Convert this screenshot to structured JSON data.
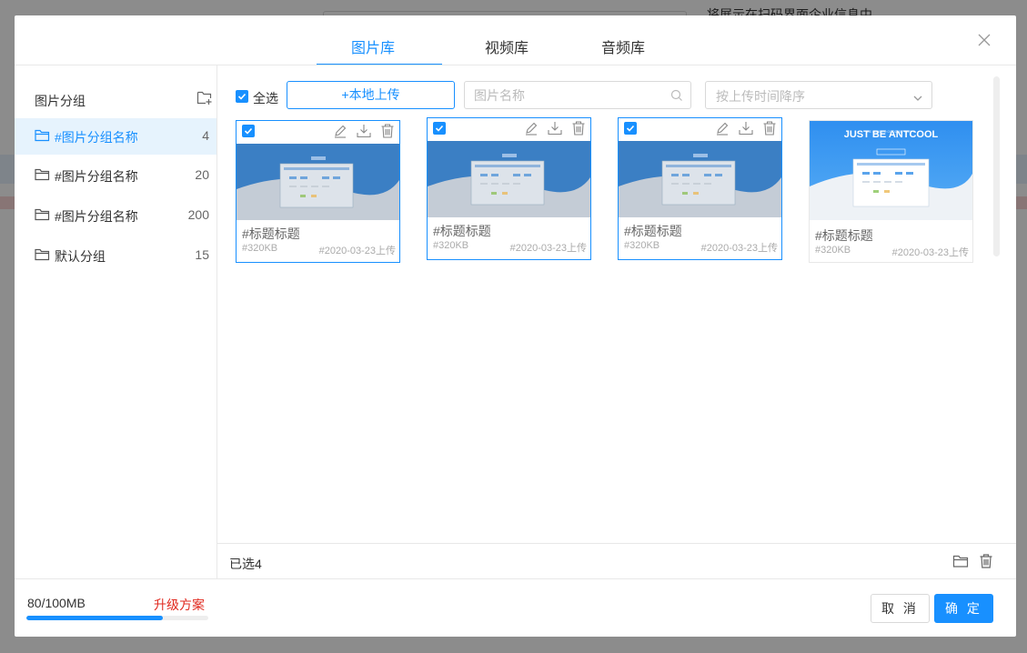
{
  "background": {
    "hint_text": "将展示在扫码界面企业信息中"
  },
  "tabs": [
    {
      "label": "图片库",
      "active": true
    },
    {
      "label": "视频库",
      "active": false
    },
    {
      "label": "音频库",
      "active": false
    }
  ],
  "sidebar": {
    "title": "图片分组",
    "groups": [
      {
        "name": "#图片分组名称",
        "count": "4",
        "active": true
      },
      {
        "name": "#图片分组名称",
        "count": "20",
        "active": false
      },
      {
        "name": "#图片分组名称",
        "count": "200",
        "active": false
      },
      {
        "name": "默认分组",
        "count": "15",
        "active": false
      }
    ]
  },
  "toolbar": {
    "select_all_label": "全选",
    "upload_label": "+本地上传",
    "search_placeholder": "图片名称",
    "sort_value": "按上传时间降序"
  },
  "thumbnail_heading": "JUST BE ANTCOOL",
  "cards": [
    {
      "title": "#标题标题",
      "size": "#320KB",
      "date": "#2020-03-23上传",
      "selected": true
    },
    {
      "title": "#标题标题",
      "size": "#320KB",
      "date": "#2020-03-23上传",
      "selected": true
    },
    {
      "title": "#标题标题",
      "size": "#320KB",
      "date": "#2020-03-23上传",
      "selected": true
    },
    {
      "title": "#标题标题",
      "size": "#320KB",
      "date": "#2020-03-23上传",
      "selected": false
    }
  ],
  "footer": {
    "selected_text": "已选4"
  },
  "bottom": {
    "storage_text": "80/100MB",
    "storage_fraction": 0.75,
    "upgrade_label": "升级方案",
    "cancel_label": "取 消",
    "ok_label": "确 定"
  },
  "colors": {
    "accent": "#1890ff",
    "danger": "#e0281e",
    "active_bg": "#e6f3fd"
  }
}
